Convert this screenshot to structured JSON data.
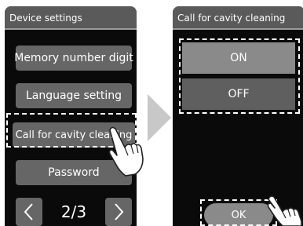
{
  "left_screen": {
    "title": "Device settings",
    "items": [
      {
        "label": "Memory number digit"
      },
      {
        "label": "Language setting"
      },
      {
        "label": "Call for cavity cleaning"
      },
      {
        "label": "Password"
      }
    ],
    "highlighted_item": "Call for cavity cleaning",
    "pager": {
      "prev_icon": "chevron-left-icon",
      "next_icon": "chevron-right-icon",
      "page_text": "2/3"
    }
  },
  "transition_arrow_icon": "arrow-right-icon",
  "right_screen": {
    "title": "Call for cavity cleaning",
    "options": [
      {
        "label": "ON",
        "selected": true
      },
      {
        "label": "OFF",
        "selected": false
      }
    ],
    "ok_label": "OK"
  },
  "icons": {
    "touch_hand": "pointing-hand-icon"
  },
  "colors": {
    "screen_background": "#0a0a0a",
    "title_bar": "#5a5a5a",
    "button": "#666666",
    "selected_option": "#8a8a8a",
    "highlight_outline": "#ffffff"
  }
}
